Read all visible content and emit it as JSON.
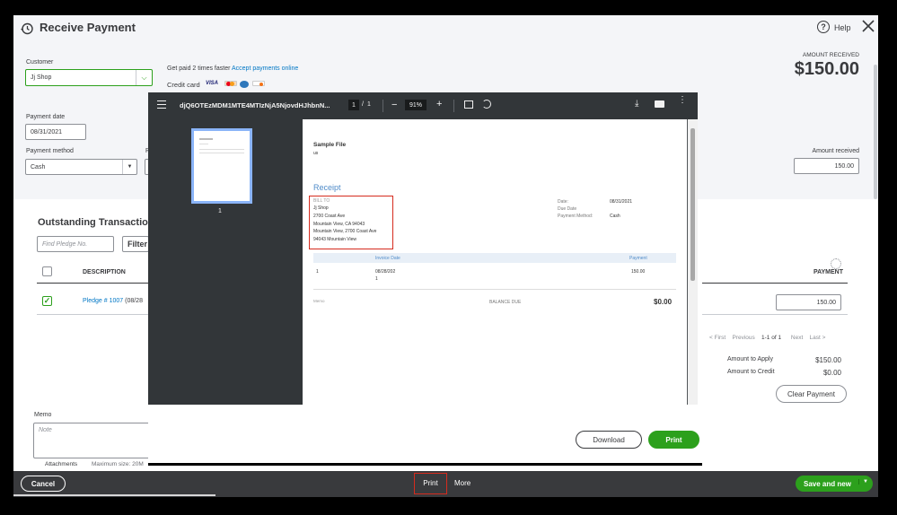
{
  "header": {
    "title": "Receive Payment",
    "help_label": "Help"
  },
  "amount_received_header": {
    "label": "AMOUNT RECEIVED",
    "value": "$150.00"
  },
  "customer": {
    "label": "Customer",
    "value": "Jj Shop"
  },
  "promo": {
    "text": "Get paid 2 times faster",
    "link": "Accept payments online",
    "credit_card_label": "Credit card"
  },
  "payment_date": {
    "label": "Payment date",
    "value": "08/31/2021"
  },
  "payment_method": {
    "label": "Payment method",
    "value": "Cash",
    "ref_label_partial": "R"
  },
  "amount_received_field": {
    "label": "Amount received",
    "value": "150.00"
  },
  "outstanding": {
    "title": "Outstanding Transactio",
    "find_placeholder": "Find Pledge No.",
    "filter_label": "Filter",
    "col_description": "DESCRIPTION",
    "col_payment": "PAYMENT",
    "row": {
      "desc_link": "Pledge # 1007",
      "desc_rest": "(08/28",
      "payment": "150.00"
    }
  },
  "pagination": {
    "first": "< First",
    "previous": "Previous",
    "range": "1-1 of 1",
    "next": "Next",
    "last": "Last >"
  },
  "totals": {
    "apply_label": "Amount to Apply",
    "apply_value": "$150.00",
    "credit_label": "Amount to Credit",
    "credit_value": "$0.00"
  },
  "clear_payment_label": "Clear Payment",
  "memo": {
    "label": "Memo",
    "placeholder": "Note"
  },
  "attachments": {
    "label": "Attachments",
    "max_size": "Maximum size: 20M"
  },
  "footer": {
    "cancel": "Cancel",
    "print": "Print",
    "more": "More",
    "save_new": "Save and new"
  },
  "pdf": {
    "filename": "djQ6OTEzMDM1MTE4MTIzNjA5NjovdHJhbnN...",
    "page_current": "1",
    "page_sep": "/",
    "page_total": "1",
    "zoom": "91%",
    "thumb_label": "1",
    "doc": {
      "title": "Sample File",
      "country": "us",
      "receipt": "Receipt",
      "bill_to_label": "BILL TO",
      "bill_to_lines": [
        "Jj Shop",
        "2700 Coast Ave",
        "Mountain View, CA 94043",
        "Mountain View, 2700 Coast Ave",
        "94043 Mountain View"
      ],
      "date_label": "Date:",
      "date_value": "08/31/2021",
      "due_label": "Due Date",
      "method_label": "Payment Method:",
      "method_value": "Cash",
      "col_invoice_date": "Invoice Date",
      "col_payment": "Payment",
      "row_num": "1",
      "row_date1": "08/28/202",
      "row_date2": "1",
      "row_payment": "150.00",
      "memo_label": "Memo",
      "balance_label": "BALANCE DUE",
      "balance_value": "$0.00"
    },
    "download_label": "Download",
    "print_label": "Print"
  },
  "colors": {
    "green": "#2ca01c",
    "link": "#0077c5",
    "highlight": "#d52b1e",
    "dark": "#393a3d"
  }
}
